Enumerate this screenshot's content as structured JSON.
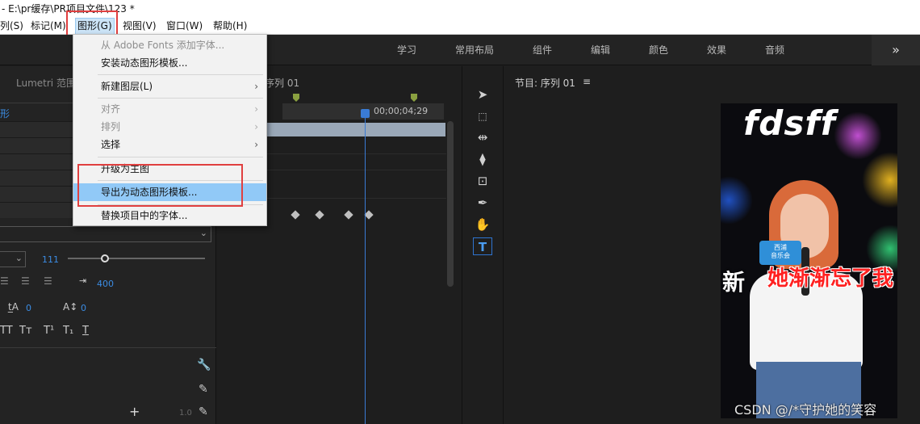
{
  "title_bar": {
    "text": "- E:\\pr缓存\\PR项目文件\\123 *"
  },
  "menu_bar": {
    "items": [
      {
        "label": "列(S)"
      },
      {
        "label": "标记(M)"
      },
      {
        "label": "图形(G)",
        "active": true
      },
      {
        "label": "视图(V)"
      },
      {
        "label": "窗口(W)"
      },
      {
        "label": "帮助(H)"
      }
    ]
  },
  "workspace_tabs": [
    {
      "label": "学习"
    },
    {
      "label": "常用布局"
    },
    {
      "label": "组件"
    },
    {
      "label": "编辑"
    },
    {
      "label": "颜色"
    },
    {
      "label": "效果"
    },
    {
      "label": "音频"
    }
  ],
  "workspace_more": "»",
  "graphics_menu": {
    "items": [
      {
        "label": "从 Adobe Fonts 添加字体...",
        "disabled": true
      },
      {
        "label": "安装动态图形模板..."
      },
      {
        "label": "新建图层(L)",
        "submenu": true
      },
      {
        "label": "对齐",
        "disabled": true,
        "submenu": true
      },
      {
        "label": "排列",
        "disabled": true,
        "submenu": true
      },
      {
        "label": "选择",
        "submenu": true
      },
      {
        "label": "升级为主图"
      },
      {
        "label": "导出为动态图形模板...",
        "highlighted": true
      },
      {
        "label": "替换项目中的字体..."
      }
    ],
    "submenu_arrow": "›"
  },
  "left_panel": {
    "tab_lumetri": "Lumetri 范围",
    "tab_shape": "形",
    "font_size_value": "111",
    "tracking_value": "400",
    "kerning_value": "0",
    "baseline_value": "0",
    "text_styles": [
      "TT",
      "Tт",
      "T¹",
      "T₁",
      "T"
    ],
    "opacity_value": "1.0",
    "add_glyph": "+"
  },
  "timeline": {
    "sequence_label": "序列 01",
    "timecode": "00;00;04;29"
  },
  "program_monitor": {
    "title": "节目: 序列 01",
    "menu_glyph": "≡",
    "video": {
      "title_text": "fdsff",
      "caption_text": "她渐渐忘了我",
      "caption_left": "新",
      "badge_text": "西浦\n音乐会"
    }
  },
  "watermark": "CSDN @/*守护她的笑容",
  "colors": {
    "accent_blue": "#2f74d0",
    "menu_highlight": "#91c9f7",
    "red_box": "#e04040",
    "panel_bg": "#232323"
  }
}
